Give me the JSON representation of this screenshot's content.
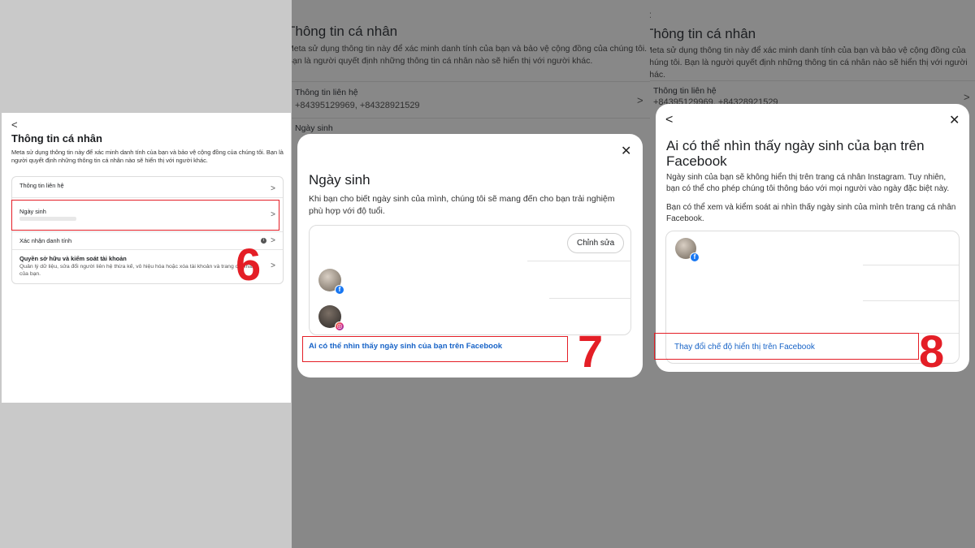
{
  "panel1": {
    "back": "<",
    "title": "Thông tin cá nhân",
    "description": "Meta sử dụng thông tin này để xác minh danh tính của bạn và bảo vệ cộng đồng của chúng tôi. Bạn là người quyết định những thông tin cá nhân nào sẽ hiển thị với người khác.",
    "rows": [
      {
        "label": "Thông tin liên hệ"
      },
      {
        "label": "Ngày sinh"
      },
      {
        "label": "Xác nhận danh tính"
      },
      {
        "label": "Quyền sở hữu và kiểm soát tài khoản",
        "description": "Quản lý dữ liệu, sửa đổi người liên hệ thừa kế, vô hiệu hóa hoặc xóa tài khoản và trang cá nhân của bạn."
      }
    ],
    "step_number": "6"
  },
  "panel2": {
    "bg_title": "Thông tin cá nhân",
    "bg_description": "Meta sử dụng thông tin này để xác minh danh tính của bạn và bảo vệ cộng đồng của chúng tôi. Bạn là người quyết định những thông tin cá nhân nào sẽ hiển thị với người khác.",
    "bg_contact_label": "Thông tin liên hệ",
    "bg_contact_value": "+84395129969, +84328921529",
    "bg_birthday_label": "Ngày sinh",
    "modal": {
      "close": "✕",
      "title": "Ngày sinh",
      "description": "Khi bạn cho biết ngày sinh của mình, chúng tôi sẽ mang đến cho bạn trải nghiệm phù hợp với độ tuổi.",
      "edit_button": "Chỉnh sửa",
      "link": "Ai có thể nhìn thấy ngày sinh của bạn trên Facebook"
    },
    "step_number": "7"
  },
  "panel3": {
    "bg_back": "<",
    "bg_title": "Thông tin cá nhân",
    "bg_description": "Meta sử dụng thông tin này để xác minh danh tính của bạn và bảo vệ cộng đồng của chúng tôi. Bạn là người quyết định những thông tin cá nhân nào sẽ hiển thị với người khác.",
    "bg_contact_label": "Thông tin liên hệ",
    "bg_contact_value": "+84395129969, +84328921529",
    "modal": {
      "back": "<",
      "close": "✕",
      "title": "Ai có thể nhìn thấy ngày sinh của bạn trên Facebook",
      "description1": "Ngày sinh của bạn sẽ không hiển thị trên trang cá nhân Instagram. Tuy nhiên, bạn có thể cho phép chúng tôi thông báo với mọi người vào ngày đặc biệt này.",
      "description2": "Bạn có thể xem và kiểm soát ai nhìn thấy ngày sinh của mình trên trang cá nhân Facebook.",
      "link": "Thay đổi chế độ hiển thị trên Facebook"
    },
    "step_number": "8"
  },
  "colors": {
    "highlight": "#e41e26",
    "link": "#1763c7",
    "facebook": "#1877f2"
  },
  "icons": [
    "back-arrow-icon",
    "chevron-right-icon",
    "close-icon",
    "info-icon",
    "facebook-badge-icon",
    "instagram-badge-icon"
  ]
}
